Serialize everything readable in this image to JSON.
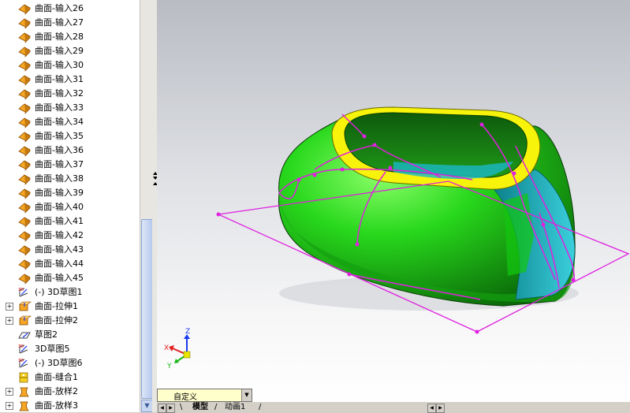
{
  "feature_tree": {
    "items": [
      {
        "label": "曲面-输入26",
        "icon": "imported-surface-icon",
        "expandable": false
      },
      {
        "label": "曲面-输入27",
        "icon": "imported-surface-icon",
        "expandable": false
      },
      {
        "label": "曲面-输入28",
        "icon": "imported-surface-icon",
        "expandable": false
      },
      {
        "label": "曲面-输入29",
        "icon": "imported-surface-icon",
        "expandable": false
      },
      {
        "label": "曲面-输入30",
        "icon": "imported-surface-icon",
        "expandable": false
      },
      {
        "label": "曲面-输入31",
        "icon": "imported-surface-icon",
        "expandable": false
      },
      {
        "label": "曲面-输入32",
        "icon": "imported-surface-icon",
        "expandable": false
      },
      {
        "label": "曲面-输入33",
        "icon": "imported-surface-icon",
        "expandable": false
      },
      {
        "label": "曲面-输入34",
        "icon": "imported-surface-icon",
        "expandable": false
      },
      {
        "label": "曲面-输入35",
        "icon": "imported-surface-icon",
        "expandable": false
      },
      {
        "label": "曲面-输入36",
        "icon": "imported-surface-icon",
        "expandable": false
      },
      {
        "label": "曲面-输入37",
        "icon": "imported-surface-icon",
        "expandable": false
      },
      {
        "label": "曲面-输入38",
        "icon": "imported-surface-icon",
        "expandable": false
      },
      {
        "label": "曲面-输入39",
        "icon": "imported-surface-icon",
        "expandable": false
      },
      {
        "label": "曲面-输入40",
        "icon": "imported-surface-icon",
        "expandable": false
      },
      {
        "label": "曲面-输入41",
        "icon": "imported-surface-icon",
        "expandable": false
      },
      {
        "label": "曲面-输入42",
        "icon": "imported-surface-icon",
        "expandable": false
      },
      {
        "label": "曲面-输入43",
        "icon": "imported-surface-icon",
        "expandable": false
      },
      {
        "label": "曲面-输入44",
        "icon": "imported-surface-icon",
        "expandable": false
      },
      {
        "label": "曲面-输入45",
        "icon": "imported-surface-icon",
        "expandable": false
      },
      {
        "label": "(-) 3D草图1",
        "icon": "3d-sketch-icon",
        "expandable": false
      },
      {
        "label": "曲面-拉伸1",
        "icon": "surface-extrude-icon",
        "expandable": true
      },
      {
        "label": "曲面-拉伸2",
        "icon": "surface-extrude-icon",
        "expandable": true
      },
      {
        "label": "草图2",
        "icon": "sketch-icon",
        "expandable": false
      },
      {
        "label": "3D草图5",
        "icon": "3d-sketch-icon",
        "expandable": false
      },
      {
        "label": "(-) 3D草图6",
        "icon": "3d-sketch-icon",
        "expandable": false
      },
      {
        "label": "曲面-缝合1",
        "icon": "surface-knit-icon",
        "expandable": false
      },
      {
        "label": "曲面-放样2",
        "icon": "surface-loft-icon",
        "expandable": true
      },
      {
        "label": "曲面-放样3",
        "icon": "surface-loft-icon",
        "expandable": true
      }
    ],
    "expander_glyph": "+"
  },
  "viewport": {
    "triad": {
      "x_label": "X",
      "y_label": "Y",
      "z_label": "Z"
    },
    "colors": {
      "body": "#22d41a",
      "rim": "#f7f30a",
      "cyan": "#1ab8c8",
      "sketch": "#e020e0"
    }
  },
  "bottom": {
    "config_value": "自定义",
    "tabs": [
      "模型",
      "动画1"
    ]
  }
}
